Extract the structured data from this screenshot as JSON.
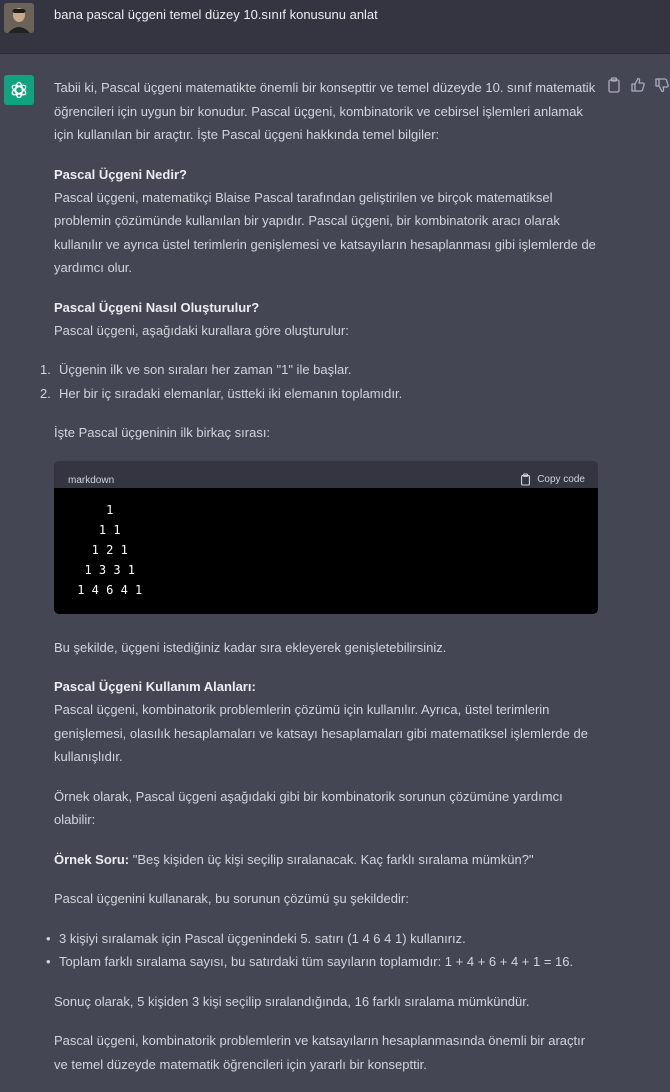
{
  "user": {
    "message": "bana pascal üçgeni temel düzey 10.sınıf konusunu anlat"
  },
  "assistant": {
    "intro": "Tabii ki, Pascal üçgeni matematikte önemli bir konsepttir ve temel düzeyde 10. sınıf matematik öğrencileri için uygun bir konudur. Pascal üçgeni, kombinatorik ve cebirsel işlemleri anlamak için kullanılan bir araçtır. İşte Pascal üçgeni hakkında temel bilgiler:",
    "section1_title": "Pascal Üçgeni Nedir?",
    "section1_text": "Pascal üçgeni, matematikçi Blaise Pascal tarafından geliştirilen ve birçok matematiksel problemin çözümünde kullanılan bir yapıdır. Pascal üçgeni, bir kombinatorik aracı olarak kullanılır ve ayrıca üstel terimlerin genişlemesi ve katsayıların hesaplanması gibi işlemlerde de yardımcı olur.",
    "section2_title": "Pascal Üçgeni Nasıl Oluşturulur?",
    "section2_text": "Pascal üçgeni, aşağıdaki kurallara göre oluşturulur:",
    "rules": [
      {
        "num": "1.",
        "text": "Üçgenin ilk ve son sıraları her zaman \"1\" ile başlar."
      },
      {
        "num": "2.",
        "text": "Her bir iç sıradaki elemanlar, üstteki iki elemanın toplamıdır."
      }
    ],
    "rows_intro": "İşte Pascal üçgeninin ilk birkaç sırası:",
    "code": {
      "language": "markdown",
      "copy_label": "Copy code",
      "content": "     1\n    1 1\n   1 2 1\n  1 3 3 1\n 1 4 6 4 1"
    },
    "after_code": "Bu şekilde, üçgeni istediğiniz kadar sıra ekleyerek genişletebilirsiniz.",
    "section3_title": "Pascal Üçgeni Kullanım Alanları:",
    "section3_text": "Pascal üçgeni, kombinatorik problemlerin çözümü için kullanılır. Ayrıca, üstel terimlerin genişlemesi, olasılık hesaplamaları ve katsayı hesaplamaları gibi matematiksel işlemlerde de kullanışlıdır.",
    "example_intro": "Örnek olarak, Pascal üçgeni aşağıdaki gibi bir kombinatorik sorunun çözümüne yardımcı olabilir:",
    "example_label": "Örnek Soru:",
    "example_question": " \"Beş kişiden üç kişi seçilip sıralanacak. Kaç farklı sıralama mümkün?\"",
    "solution_intro": "Pascal üçgenini kullanarak, bu sorunun çözümü şu şekildedir:",
    "bullets": [
      {
        "dot": "•",
        "text": "3 kişiyi sıralamak için Pascal üçgenindeki 5. satırı (1 4 6 4 1) kullanırız."
      },
      {
        "dot": "•",
        "text": "Toplam farklı sıralama sayısı, bu satırdaki tüm sayıların toplamıdır: 1 + 4 + 6 + 4 + 1 = 16."
      }
    ],
    "conclusion": "Sonuç olarak, 5 kişiden 3 kişi seçilip sıralandığında, 16 farklı sıralama mümkündür.",
    "final": "Pascal üçgeni, kombinatorik problemlerin ve katsayıların hesaplanmasında önemli bir araçtır ve temel düzeyde matematik öğrencileri için yararlı bir konsepttir."
  },
  "icons": {
    "assistant_avatar": "openai-logo-icon",
    "copy": "clipboard-icon",
    "thumbs_up": "thumbs-up-icon",
    "thumbs_down": "thumbs-down-icon"
  },
  "colors": {
    "assistant_bg": "#444654",
    "user_bg": "#343541",
    "brand_green": "#10a37f",
    "code_bg": "#000000"
  }
}
